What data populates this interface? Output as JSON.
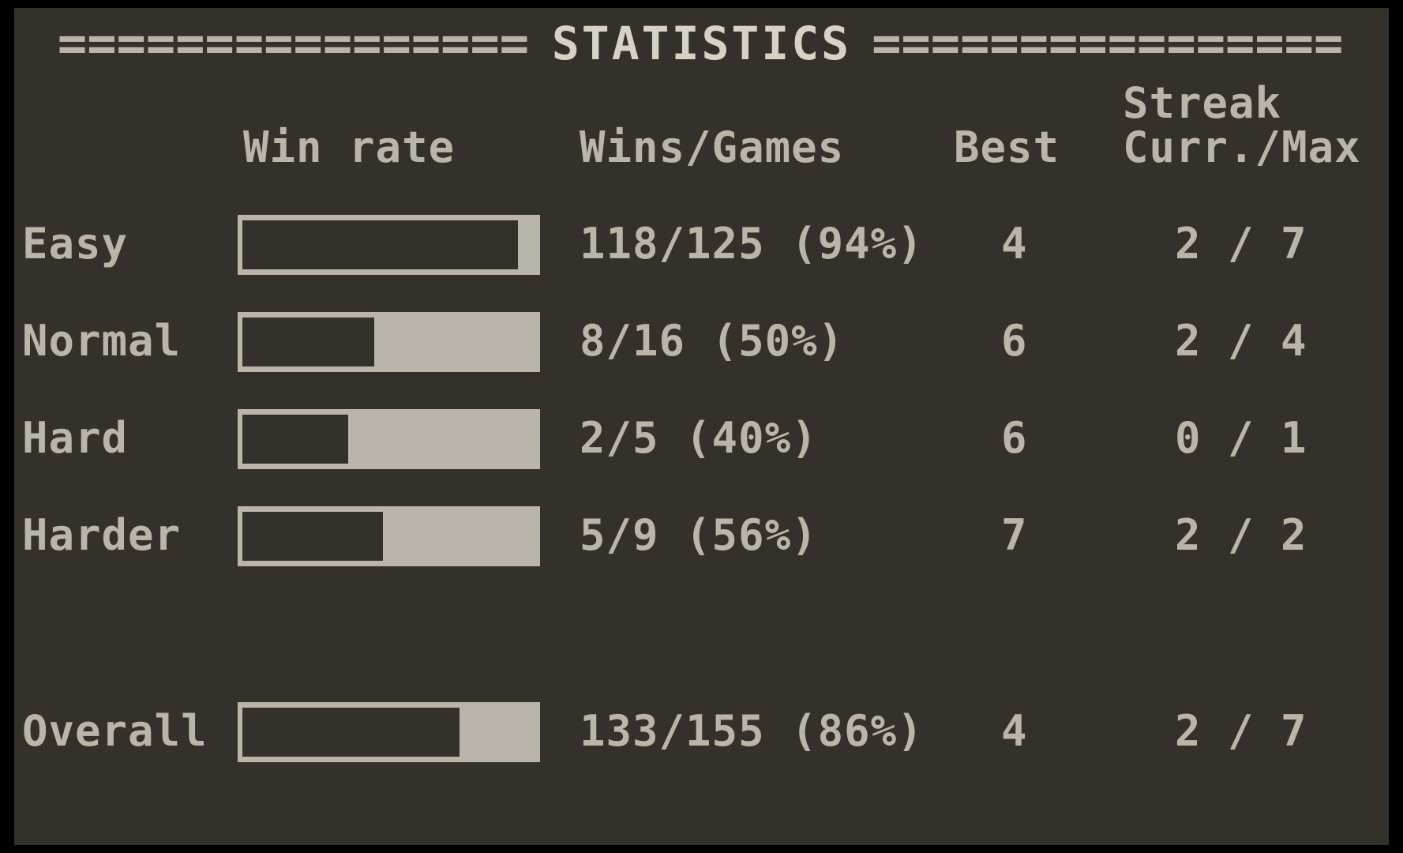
{
  "window": {
    "title": "STATISTICS",
    "rule_left": "================",
    "rule_right": "===================",
    "background_color": "#33312a",
    "text_color": "#bab5ab",
    "border_color": "#000000"
  },
  "columns": {
    "win_rate": "Win rate",
    "wins_games": "Wins/Games",
    "best": "Best",
    "streak": "Streak",
    "curr_max": "Curr./Max"
  },
  "chart_data": {
    "type": "bar",
    "title": "STATISTICS",
    "xlabel": "",
    "ylabel": "Win rate",
    "categories": [
      "Easy",
      "Normal",
      "Hard",
      "Harder",
      "Overall"
    ],
    "values": [
      94,
      50,
      40,
      56,
      86
    ],
    "ylim": [
      0,
      100
    ],
    "grid": false,
    "legend": "none",
    "orientation": "horizontal",
    "value_unit": "%"
  },
  "rows": [
    {
      "label": "Easy",
      "win_rate_pct": 94,
      "bar_empty_pct": 94,
      "wins_games": "118/125 (94%)",
      "best": "4",
      "streak": "2 / 7",
      "spaced": false
    },
    {
      "label": "Normal",
      "win_rate_pct": 50,
      "bar_empty_pct": 45,
      "wins_games": "8/16 (50%)",
      "best": "6",
      "streak": "2 / 4",
      "spaced": false
    },
    {
      "label": "Hard",
      "win_rate_pct": 40,
      "bar_empty_pct": 36,
      "wins_games": "2/5 (40%)",
      "best": "6",
      "streak": "0 / 1",
      "spaced": false
    },
    {
      "label": "Harder",
      "win_rate_pct": 56,
      "bar_empty_pct": 48,
      "wins_games": "5/9 (56%)",
      "best": "7",
      "streak": "2 / 2",
      "spaced": false
    },
    {
      "label": "Overall",
      "win_rate_pct": 86,
      "bar_empty_pct": 74,
      "wins_games": "133/155 (86%)",
      "best": "4",
      "streak": "2 / 7",
      "spaced": true
    }
  ]
}
